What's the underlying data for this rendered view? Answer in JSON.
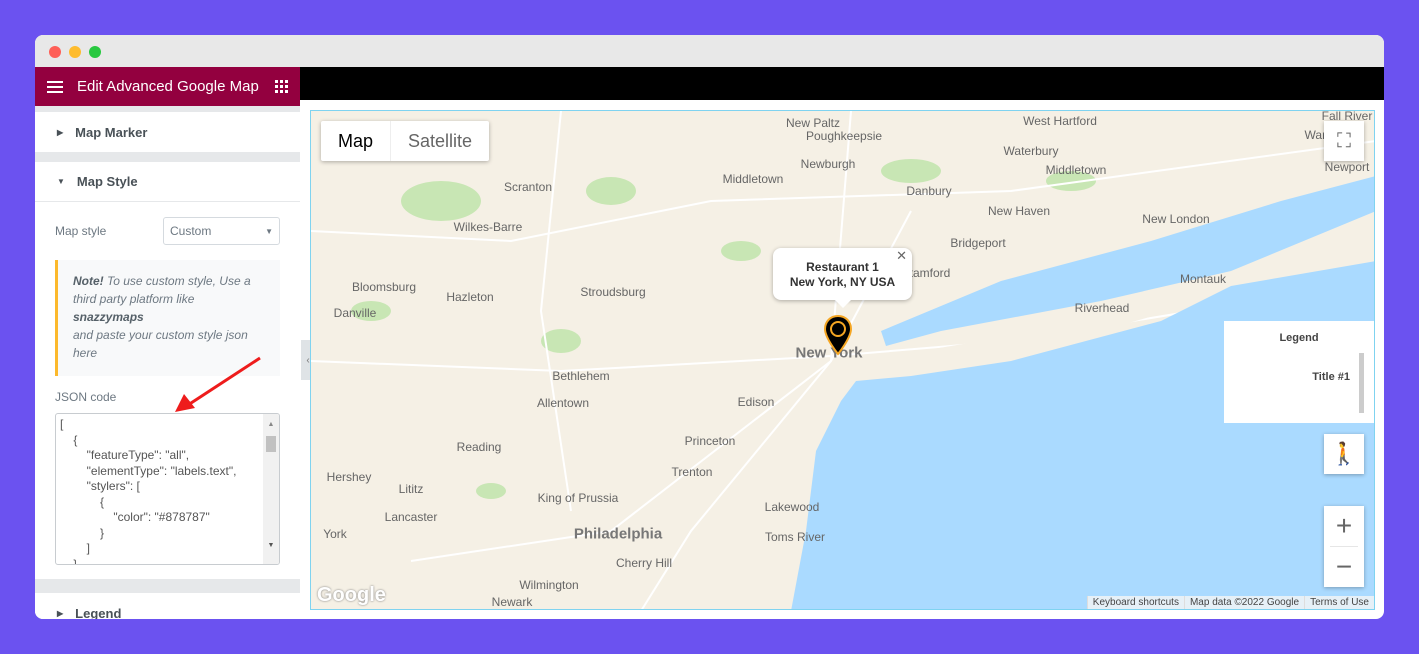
{
  "panel": {
    "title": "Edit Advanced Google Map",
    "sections": {
      "map_marker": "Map Marker",
      "map_style": "Map Style",
      "legend": "Legend"
    },
    "map_style_label": "Map style",
    "map_style_value": "Custom",
    "note": {
      "strong": "Note!",
      "text1": " To use custom style, Use a third party platform like ",
      "link": "snazzymaps",
      "text2": " and paste your custom style json here"
    },
    "json_label": "JSON code",
    "json_lines": [
      "[",
      "    {",
      "        \"featureType\": \"all\",",
      "        \"elementType\": \"labels.text\",",
      "        \"stylers\": [",
      "            {",
      "                \"color\": \"#878787\"",
      "            }",
      "        ]",
      "    },",
      "    {"
    ]
  },
  "map": {
    "tabs": [
      "Map",
      "Satellite"
    ],
    "active_tab": "Map",
    "info": {
      "title": "Restaurant 1",
      "address": "New York, NY USA"
    },
    "legend": {
      "title": "Legend",
      "item": "Title #1"
    },
    "attribution": [
      "Keyboard shortcuts",
      "Map data ©2022 Google",
      "Terms of Use"
    ],
    "logo": "Google",
    "cities": [
      "New Paltz",
      "Poughkeepsie",
      "West Hartford",
      "Fall River",
      "Warwick",
      "Waterbury",
      "Newburgh",
      "Middletown",
      "Middletown",
      "Newport",
      "Scranton",
      "Danbury",
      "Wilkes-Barre",
      "New Haven",
      "New London",
      "Bridgeport",
      "Stamford",
      "Bloomsburg",
      "Hazleton",
      "Stroudsburg",
      "Montauk",
      "Danville",
      "Riverhead",
      "New York",
      "Bethlehem",
      "Allentown",
      "Edison",
      "Reading",
      "Princeton",
      "Hershey",
      "Lititz",
      "Trenton",
      "King of Prussia",
      "Lakewood",
      "Lancaster",
      "York",
      "Philadelphia",
      "Toms River",
      "Cherry Hill",
      "Wilmington",
      "Newark"
    ],
    "colors": {
      "land": "#f5f0e5",
      "water": "#aadaff",
      "park": "#c8e6b4",
      "marker": "#000000",
      "marker_ring": "#f5a623"
    }
  },
  "colors": {
    "background": "#6b52f0",
    "header": "#93003f",
    "note_border": "#fcb92c",
    "arrow": "#ee1c1c"
  }
}
